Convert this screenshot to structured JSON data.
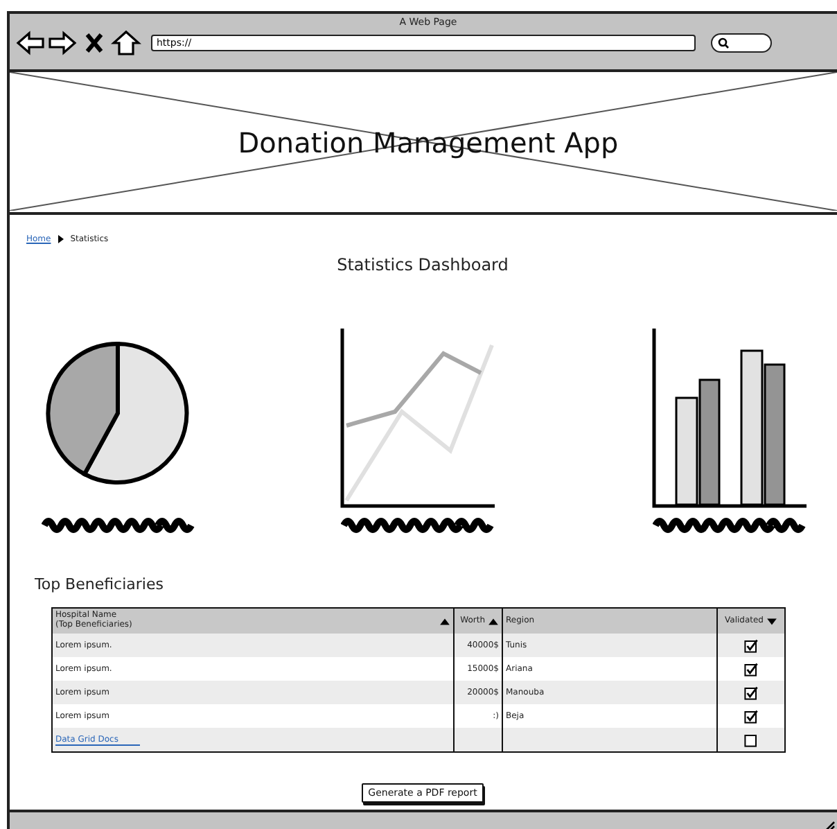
{
  "window": {
    "title": "A Web Page",
    "address": "https://"
  },
  "header": {
    "title": "Donation Management App"
  },
  "breadcrumb": [
    {
      "label": "Home",
      "kind": "link"
    },
    {
      "label": "Statistics",
      "kind": "current"
    }
  ],
  "page_title": "Statistics Dashboard",
  "charts": [
    {
      "kind": "pie"
    },
    {
      "kind": "line"
    },
    {
      "kind": "bar"
    }
  ],
  "table": {
    "title": "Top Beneficiaries",
    "columns": [
      {
        "label": "Hospital Name\n(Top Beneficiaries)",
        "sorted": true,
        "descending": false
      },
      {
        "label": "Worth",
        "sorted": true,
        "descending": false
      },
      {
        "label": "Region",
        "sorted": false
      },
      {
        "label": "Validated",
        "sorted": true,
        "descending": true
      }
    ],
    "rows": [
      {
        "kind": "text",
        "name": "Lorem ipsum.",
        "worth": "40000$",
        "region": "Tunis",
        "checked": true
      },
      {
        "kind": "text",
        "name": "Lorem ipsum.",
        "worth": "15000$",
        "region": "Ariana",
        "checked": true
      },
      {
        "kind": "text",
        "name": "Lorem ipsum",
        "worth": "20000$",
        "region": "Manouba",
        "checked": true
      },
      {
        "kind": "text",
        "name": "Lorem ipsum",
        "worth": ":)",
        "region": "Beja",
        "checked": true
      },
      {
        "kind": "link",
        "name": "Data Grid Docs",
        "checked": false
      }
    ]
  },
  "button": "Generate a PDF report"
}
